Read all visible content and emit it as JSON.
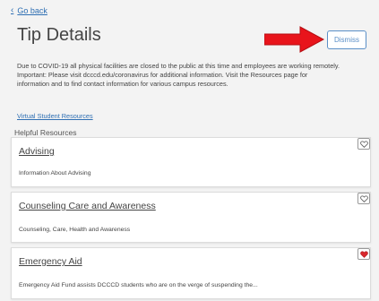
{
  "nav": {
    "back_label": "Go back"
  },
  "page": {
    "title": "Tip Details",
    "dismiss_label": "Dismiss",
    "intro_line1": "Due to COVID-19 all physical facilities are closed to the public at this time and employees are working remotely.",
    "intro_line2": "Important:  Please visit dcccd.edu/coronavirus for additional information. Visit the Resources page for",
    "intro_line3": "information and to find contact information for various campus resources.",
    "virtual_link": "Virtual Student Resources",
    "section_title": "Helpful Resources"
  },
  "resources": [
    {
      "title": "Advising",
      "description": "Information About Advising",
      "favorited": false
    },
    {
      "title": "Counseling Care and Awareness",
      "description": "Counseling, Care, Health and Awareness",
      "favorited": false
    },
    {
      "title": "Emergency Aid",
      "description": "Emergency Aid Fund assists DCCCD students who are on the verge of suspending the...",
      "favorited": true
    }
  ],
  "colors": {
    "link": "#2f6fb3",
    "arrow": "#e8141b",
    "heart_active": "#d9262c"
  }
}
